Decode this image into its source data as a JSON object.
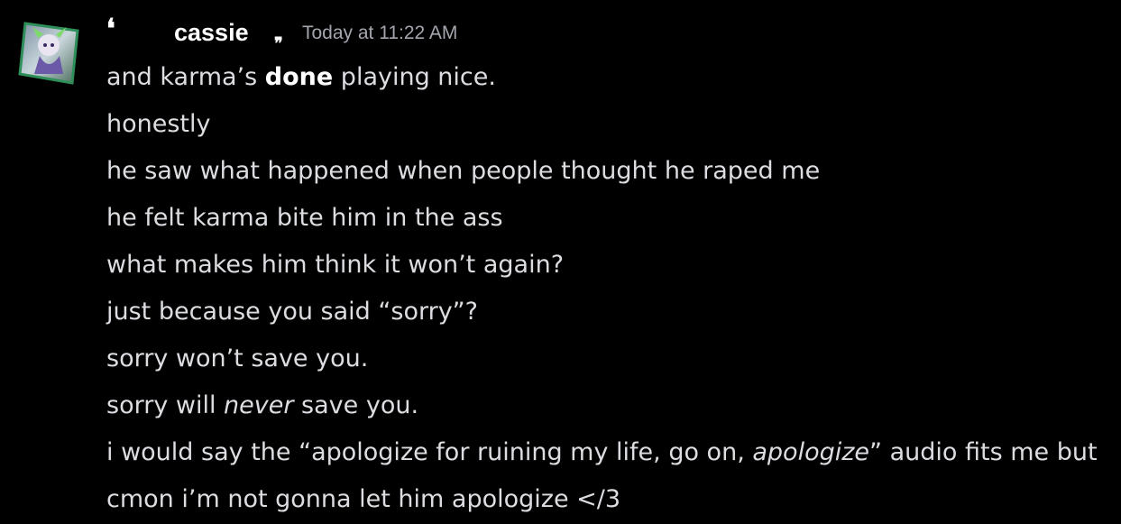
{
  "message": {
    "author": "cassie",
    "timestamp": "Today at 11:22 AM",
    "quote_open": "❛",
    "quote_close": "❞",
    "lines": [
      {
        "pre": "and karma’s ",
        "bold": "done",
        "post": " playing nice."
      },
      {
        "text": "honestly"
      },
      {
        "text": "he saw what happened when people thought he raped me"
      },
      {
        "text": "he felt karma bite him in the ass"
      },
      {
        "text": "what makes him think it won’t again?"
      },
      {
        "text": "just because you said “sorry”?"
      },
      {
        "text": "sorry won’t save you."
      },
      {
        "pre": "sorry will ",
        "italic": "never",
        "post": " save you."
      },
      {
        "pre": "i would say the “apologize for ruining my life, go on, ",
        "italic": "apologize",
        "post": "” audio fits me but"
      },
      {
        "text": "cmon i’m not gonna let him apologize </3"
      }
    ]
  },
  "colors": {
    "background": "#000000",
    "username": "#ffffff",
    "timestamp": "#a3a6ad",
    "text": "#dcdde1"
  },
  "avatar": {
    "icon": "anime-character-avatar-icon"
  }
}
